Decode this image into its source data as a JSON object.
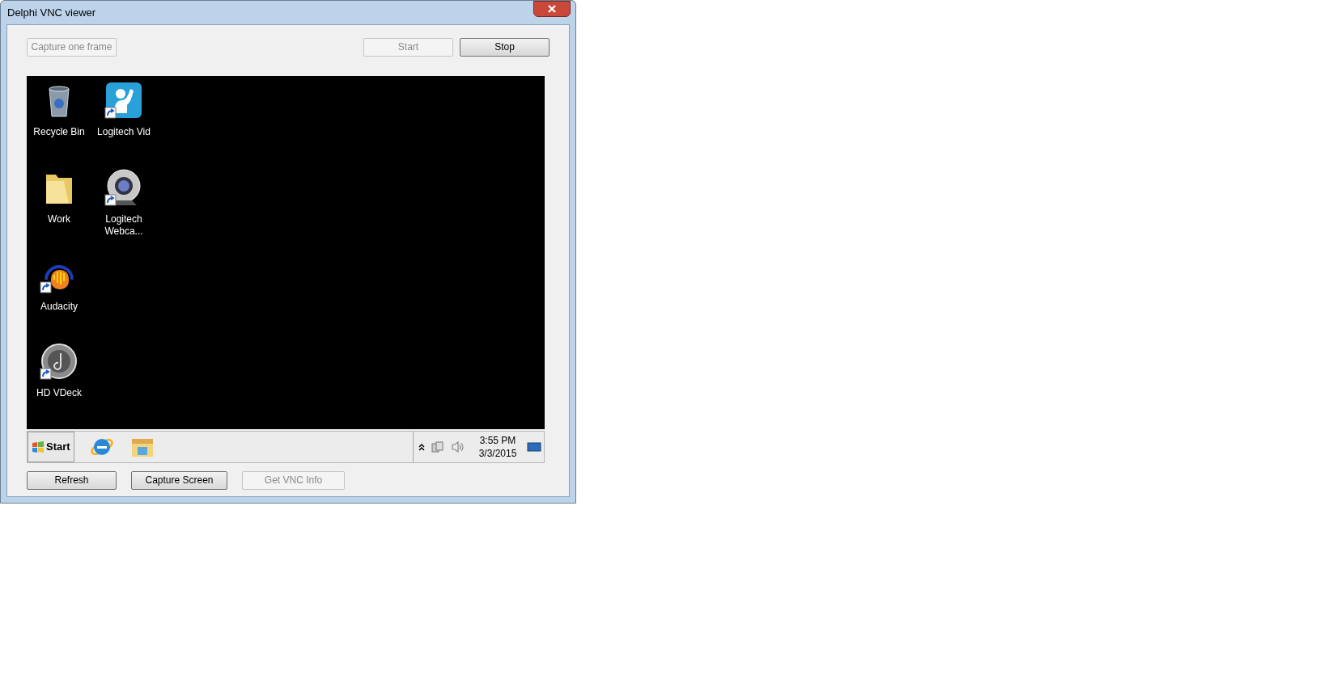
{
  "window": {
    "title": "Delphi VNC viewer"
  },
  "top_left_buttons": [
    {
      "label": "Capture one frame",
      "disabled": true
    }
  ],
  "top_right_buttons": [
    {
      "label": "Start",
      "disabled": true
    },
    {
      "label": "Stop",
      "disabled": false
    }
  ],
  "desktop_icons": [
    {
      "label": "Recycle Bin",
      "kind": "recycle",
      "shortcut": false
    },
    {
      "label": "Work",
      "kind": "folder",
      "shortcut": false
    },
    {
      "label": "Audacity",
      "kind": "audio",
      "shortcut": true
    },
    {
      "label": "HD VDeck",
      "kind": "disc",
      "shortcut": true
    },
    {
      "label": "Logitech Vid",
      "kind": "person",
      "shortcut": true
    },
    {
      "label": "Logitech Webca...",
      "kind": "webcam",
      "shortcut": true
    }
  ],
  "taskbar": {
    "start_label": "Start",
    "pinned": [
      {
        "kind": "browser"
      },
      {
        "kind": "explorer"
      }
    ],
    "time": "3:55 PM",
    "date": "3/3/2015"
  },
  "bottom_buttons": [
    {
      "label": "Refresh",
      "disabled": false
    },
    {
      "label": "Capture Screen",
      "disabled": false
    },
    {
      "label": "Get VNC Info",
      "disabled": true
    }
  ]
}
